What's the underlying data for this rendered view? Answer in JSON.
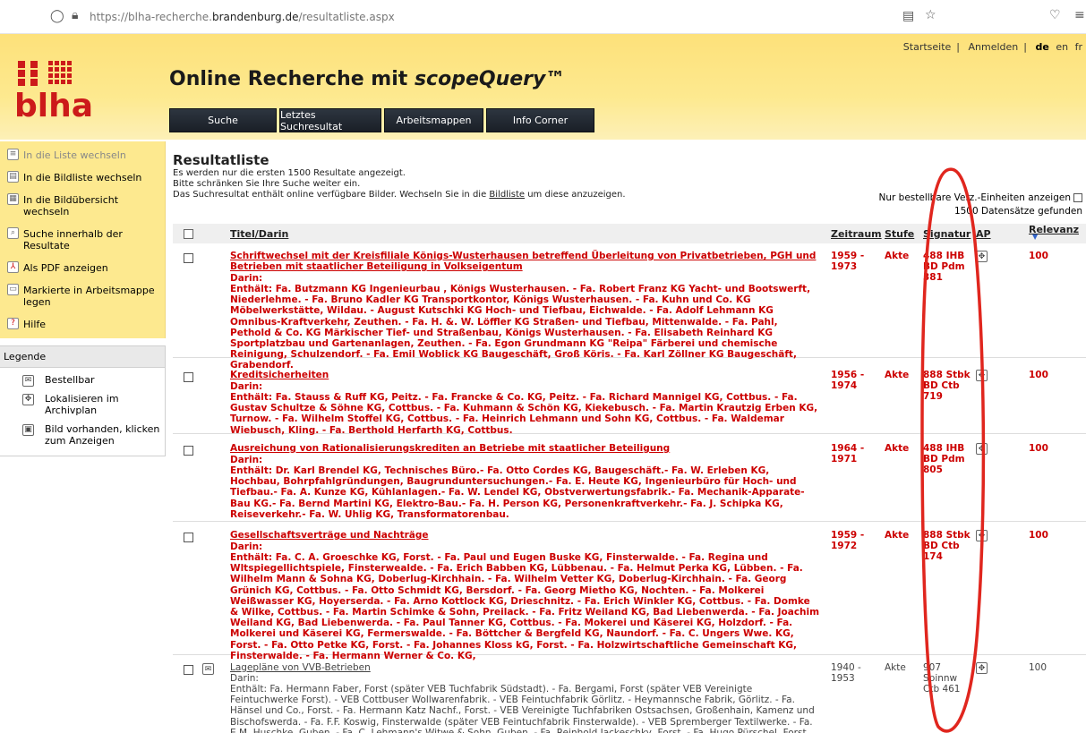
{
  "browser": {
    "url_prefix": "https://blha-recherche.",
    "url_domain": "brandenburg.de",
    "url_suffix": "/resultatliste.aspx"
  },
  "header": {
    "links": [
      "Startseite",
      "Anmelden"
    ],
    "lang_current": "de",
    "lang_others": [
      "en",
      "fr"
    ],
    "title_main": "Online Recherche mit ",
    "title_brand": "scopeQuery",
    "title_tm": "™",
    "logo_text": "blha",
    "menu": [
      "Suche",
      "Letztes Suchresultat",
      "Arbeitsmappen",
      "Info Corner"
    ]
  },
  "sidebar": {
    "items": [
      {
        "label": "In die Liste wechseln",
        "icon": "list-icon"
      },
      {
        "label": "In die Bildliste wechseln",
        "icon": "image-list-icon"
      },
      {
        "label": "In die Bildübersicht wechseln",
        "icon": "image-grid-icon"
      },
      {
        "label": "Suche innerhalb der Resultate",
        "icon": "search-within-icon"
      },
      {
        "label": "Als PDF anzeigen",
        "icon": "pdf-icon"
      },
      {
        "label": "Markierte in Arbeitsmappe legen",
        "icon": "folder-icon"
      },
      {
        "label": "Hilfe",
        "icon": "help-icon"
      }
    ],
    "legend_title": "Legende",
    "legend": [
      {
        "label": "Bestellbar",
        "icon": "orderable-icon"
      },
      {
        "label": "Lokalisieren im Archivplan",
        "icon": "locate-icon"
      },
      {
        "label": "Bild vorhanden, klicken zum Anzeigen",
        "icon": "image-available-icon"
      }
    ]
  },
  "main": {
    "title": "Resultatliste",
    "info1": "Es werden nur die ersten 1500 Resultate angezeigt.",
    "info2": "Bitte schränken Sie Ihre Suche weiter ein.",
    "info3_pre": "Das Suchresultat enthält online verfügbare Bilder. Wechseln Sie in die ",
    "info3_link": "Bildliste",
    "info3_post": " um diese anzuzeigen.",
    "filter_label": "Nur bestellbare Verz.-Einheiten anzeigen",
    "count": "1500 Datensätze gefunden"
  },
  "table": {
    "headers": {
      "title": "Titel/Darin",
      "zeit": "Zeitraum",
      "stufe": "Stufe",
      "sig": "Signatur",
      "ap": "AP",
      "rel": "Relevanz"
    },
    "rows": [
      {
        "title": "Schriftwechsel mit der Kreisfiliale Königs-Wusterhausen betreffend Überleitung von Privatbetrieben, PGH und Betrieben mit staatlicher Beteiligung in Volkseigentum",
        "darin": "Darin:",
        "contains": "Enthält: Fa. Butzmann KG Ingenieurbau , Königs Wusterhausen. - Fa. Robert Franz KG Yacht- und Bootswerft, Niederlehme. - Fa. Bruno Kadler KG Transportkontor, Königs Wusterhausen. - Fa. Kuhn und Co. KG Möbelwerkstätte, Wildau. - August Kutschki KG Hoch- und Tiefbau, Eichwalde. - Fa. Adolf Lehmann KG Omnibus-Kraftverkehr, Zeuthen. - Fa. H. &. W. Löffler KG Straßen- und Tiefbau, Mittenwalde. - Fa. Pahl, Pethold & Co. KG Märkischer Tief- und Straßenbau, Königs Wusterhausen. - Fa. Elisabeth Reinhard KG Sportplatzbau und Gartenanlagen, Zeuthen. - Fa. Egon Grundmann KG \"Reipa\" Färberei und chemische Reinigung, Schulzendorf. - Fa. Emil Woblick KG Baugeschäft, Groß Köris. - Fa. Karl Zöllner KG Baugeschäft, Grabendorf.",
        "zeit": "1959 - 1973",
        "stufe": "Akte",
        "sig": "488 IHB BD Pdm 381",
        "rel": "100",
        "style": "red"
      },
      {
        "title": "Kreditsicherheiten",
        "darin": "Darin:",
        "contains": "Enthält: Fa. Stauss & Ruff KG, Peitz. - Fa. Francke & Co. KG, Peitz. - Fa. Richard Mannigel KG, Cottbus. - Fa. Gustav Schultze & Söhne KG, Cottbus. - Fa. Kuhmann & Schön KG, Kiekebusch. - Fa. Martin Krautzig Erben KG, Turnow. - Fa. Wilhelm Stoffel KG, Cottbus. - Fa. Heinrich Lehmann und Sohn KG, Cottbus. - Fa. Waldemar Wiebusch, Kling. - Fa. Berthold Herfarth KG, Cottbus.",
        "zeit": "1956 - 1974",
        "stufe": "Akte",
        "sig": "888 Stbk BD Ctb 719",
        "rel": "100",
        "style": "red"
      },
      {
        "title": "Ausreichung von Rationalisierungskrediten an Betriebe mit staatlicher Beteiligung",
        "darin": "Darin:",
        "contains": "Enthält: Dr. Karl Brendel KG, Technisches Büro.- Fa. Otto Cordes KG, Baugeschäft.- Fa. W. Erleben KG, Hochbau, Bohrpfahlgründungen, Baugrunduntersuchungen.- Fa. E. Heute KG, Ingenieurbüro für Hoch- und Tiefbau.- Fa. A. Kunze KG, Kühlanlagen.- Fa. W. Lendel KG, Obstverwertungsfabrik.- Fa. Mechanik-Apparate-Bau KG.- Fa. Bernd Martini KG, Elektro-Bau.- Fa. H. Person KG, Personenkraftverkehr.- Fa. J. Schipka KG, Reiseverkehr.- Fa. W. Uhlig KG, Transformatorenbau.",
        "zeit": "1964 - 1971",
        "stufe": "Akte",
        "sig": "488 IHB BD Pdm 805",
        "rel": "100",
        "style": "red"
      },
      {
        "title": "Gesellschaftsverträge und Nachträge",
        "darin": "Darin:",
        "contains": "Enthält: Fa. C. A. Groeschke KG, Forst. - Fa. Paul und Eugen Buske KG, Finsterwalde. - Fa. Regina und Wltspiegellichtspiele, Finsterwealde. - Fa. Erich Babben KG, Lübbenau. - Fa. Helmut Perka KG, Lübben. - Fa. Wilhelm Mann & Sohna KG, Doberlug-Kirchhain. - Fa. Wilhelm Vetter KG, Doberlug-Kirchhain. - Fa. Georg Grünich KG, Cottbus. - Fa. Otto Schmidt KG, Bersdorf. - Fa. Georg Mietho KG, Nochten. - Fa. Molkerei Weißwasser KG, Hoyerserda. - Fa. Arno Kottlock KG, Drieschnitz. - Fa. Erich Winkler KG, Cottbus. - Fa. Domke & Wilke, Cottbus. - Fa. Martin Schimke & Sohn, Preilack. - Fa. Fritz Weiland KG, Bad Liebenwerda. - Fa. Joachim Weiland KG, Bad Liebenwerda. - Fa. Paul Tanner KG, Cottbus. - Fa. Mokerei und Käserei KG, Holzdorf. - Fa. Molkerei und Käserei KG, Fermerswalde. - Fa. Böttcher & Bergfeld KG, Naundorf. - Fa. C. Ungers Wwe. KG, Forst. - Fa. Otto Petke KG, Forst. - Fa. Johannes Kloss kG, Forst. - Fa. Holzwirtschaftliche Gemeinschaft KG, Finsterwalde. - Fa. Hermann Werner & Co. KG,",
        "zeit": "1959 - 1972",
        "stufe": "Akte",
        "sig": "888 Stbk BD Ctb 174",
        "rel": "100",
        "style": "red"
      },
      {
        "title": "Lagepläne von VVB-Betrieben",
        "darin": "Darin:",
        "contains": "Enthält: Fa. Hermann Faber, Forst (später VEB Tuchfabrik Südstadt). - Fa. Bergami, Forst (später VEB Vereinigte Feintuchwerke Forst). - VEB Cottbuser Wollwarenfabrik. - VEB Feintuchfabrik Görlitz. - Heymannsche Fabrik, Görlitz. - Fa. Hänsel und Co., Forst. - Fa. Hermann Katz Nachf., Forst. - VEB Vereinigte Tuchfabriken Ostsachsen, Großenhain, Kamenz und Bischofswerda. - Fa. F.F. Koswig, Finsterwalde (später VEB Feintuchfabrik Finsterwalde). - VEB Spremberger Textilwerke. - Fa. E.M. Huschke, Guben. - Fa. C. Lehmann's Witwe & Sohn, Guben. - Fa. Reinhold Jackeschky, Forst. - Fa. Hugo Pürschel, Forst.",
        "zeit": "1940 - 1953",
        "stufe": "Akte",
        "sig": "907 Spinnw Ctb 461",
        "rel": "100",
        "style": "grey"
      }
    ]
  }
}
